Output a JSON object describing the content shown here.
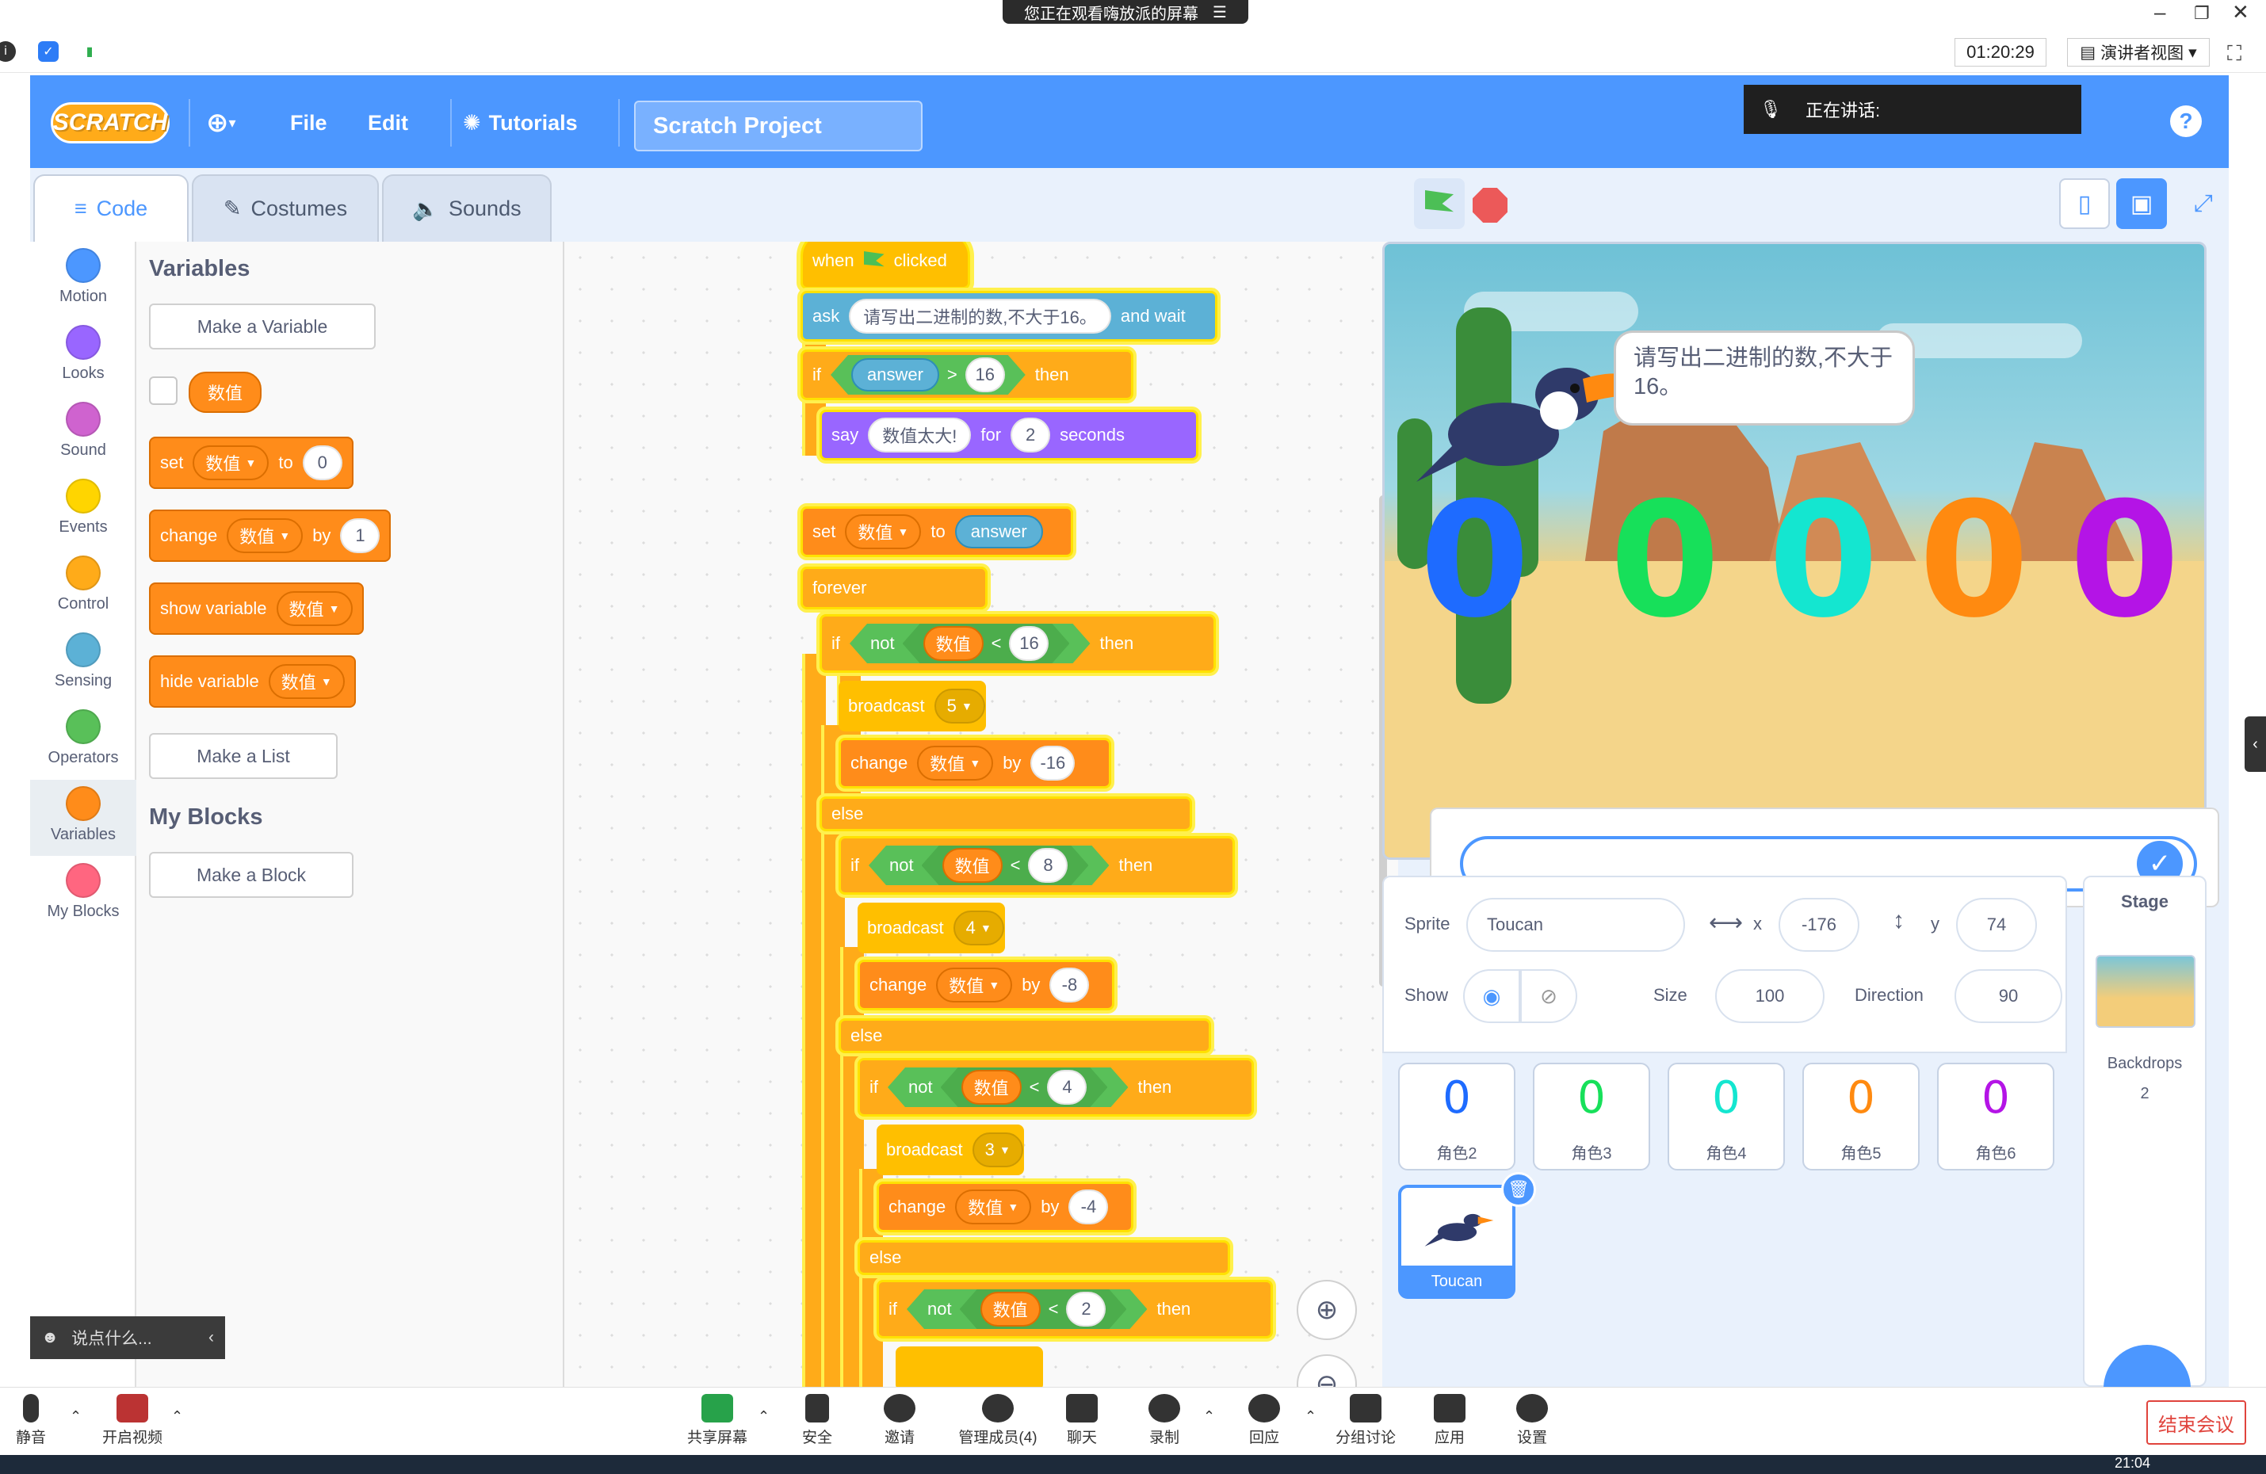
{
  "meeting": {
    "share_banner": "您正在观看嗨放派的屏幕",
    "timer": "01:20:29",
    "presenter_view": "演讲者视图",
    "speaking_label": "正在讲话:",
    "chat_placeholder": "说点什么...",
    "bottom": [
      {
        "label": "静音"
      },
      {
        "label": "开启视频"
      },
      {
        "label": "共享屏幕"
      },
      {
        "label": "安全"
      },
      {
        "label": "邀请"
      },
      {
        "label": "管理成员(4)"
      },
      {
        "label": "聊天"
      },
      {
        "label": "录制"
      },
      {
        "label": "回应"
      },
      {
        "label": "分组讨论"
      },
      {
        "label": "应用"
      },
      {
        "label": "设置"
      }
    ],
    "end_button": "结束会议",
    "clock": "21:04"
  },
  "scratch": {
    "logo": "SCRATCH",
    "menu": {
      "file": "File",
      "edit": "Edit",
      "tutorials": "Tutorials",
      "project_title": "Scratch Project"
    },
    "tabs": {
      "code": "Code",
      "costumes": "Costumes",
      "sounds": "Sounds"
    },
    "categories": [
      {
        "label": "Motion",
        "color": "#4c97ff"
      },
      {
        "label": "Looks",
        "color": "#9966ff"
      },
      {
        "label": "Sound",
        "color": "#cf63cf"
      },
      {
        "label": "Events",
        "color": "#ffd500"
      },
      {
        "label": "Control",
        "color": "#ffab19"
      },
      {
        "label": "Sensing",
        "color": "#5cb1d6"
      },
      {
        "label": "Operators",
        "color": "#59c059"
      },
      {
        "label": "Variables",
        "color": "#ff8c1a"
      },
      {
        "label": "My Blocks",
        "color": "#ff6680"
      }
    ],
    "palette": {
      "variables_heading": "Variables",
      "make_variable": "Make a Variable",
      "variable_name": "数值",
      "set_block": {
        "kw": "set",
        "var": "数值",
        "to": "to",
        "value": "0"
      },
      "change_block": {
        "kw": "change",
        "var": "数值",
        "by": "by",
        "value": "1"
      },
      "show_block": {
        "kw": "show variable",
        "var": "数值"
      },
      "hide_block": {
        "kw": "hide variable",
        "var": "数值"
      },
      "make_list": "Make a List",
      "myblocks_heading": "My Blocks",
      "make_block": "Make a Block"
    },
    "script": {
      "when_clicked": {
        "when": "when",
        "clicked": "clicked"
      },
      "ask": {
        "kw": "ask",
        "text": "请写出二进制的数,不大于16。",
        "wait": "and wait"
      },
      "if1": {
        "if": "if",
        "answer": "answer",
        "op": ">",
        "num": "16",
        "then": "then"
      },
      "say": {
        "kw": "say",
        "text": "数值太大!",
        "for": "for",
        "num": "2",
        "seconds": "seconds"
      },
      "set": {
        "kw": "set",
        "var": "数值",
        "to": "to",
        "value": "answer"
      },
      "forever": "forever",
      "if2": {
        "if": "if",
        "not": "not",
        "var": "数值",
        "op": "<",
        "num": "16",
        "then": "then"
      },
      "broadcast5": {
        "kw": "broadcast",
        "msg": "5"
      },
      "change16": {
        "kw": "change",
        "var": "数值",
        "by": "by",
        "num": "-16"
      },
      "else1": "else",
      "if3": {
        "if": "if",
        "not": "not",
        "var": "数值",
        "op": "<",
        "num": "8",
        "then": "then"
      },
      "broadcast4": {
        "kw": "broadcast",
        "msg": "4"
      },
      "change8": {
        "kw": "change",
        "var": "数值",
        "by": "by",
        "num": "-8"
      },
      "else2": "else",
      "if4": {
        "if": "if",
        "not": "not",
        "var": "数值",
        "op": "<",
        "num": "4",
        "then": "then"
      },
      "broadcast3": {
        "kw": "broadcast",
        "msg": "3"
      },
      "change4": {
        "kw": "change",
        "var": "数值",
        "by": "by",
        "num": "-4"
      },
      "else3": "else",
      "if5": {
        "if": "if",
        "not": "not",
        "var": "数值",
        "op": "<",
        "num": "2",
        "then": "then"
      }
    },
    "stage": {
      "speech": "请写出二进制的数,不大于16。",
      "digits": [
        {
          "text": "0",
          "color": "#1e6bff"
        },
        {
          "text": "0",
          "color": "#17e05a"
        },
        {
          "text": "0",
          "color": "#14e6d0"
        },
        {
          "text": "0",
          "color": "#ff8a10"
        },
        {
          "text": "0",
          "color": "#b414e6"
        }
      ]
    },
    "sprite_info": {
      "sprite_label": "Sprite",
      "sprite_name": "Toucan",
      "x_label": "x",
      "x_value": "-176",
      "y_label": "y",
      "y_value": "74",
      "show_label": "Show",
      "size_label": "Size",
      "size_value": "100",
      "direction_label": "Direction",
      "direction_value": "90"
    },
    "sprites": [
      {
        "glyph": "0",
        "name": "角色2",
        "color": "#1e6bff"
      },
      {
        "glyph": "0",
        "name": "角色3",
        "color": "#17e05a"
      },
      {
        "glyph": "0",
        "name": "角色4",
        "color": "#14e6d0"
      },
      {
        "glyph": "0",
        "name": "角色5",
        "color": "#ff8a10"
      },
      {
        "glyph": "0",
        "name": "角色6",
        "color": "#b414e6"
      }
    ],
    "selected_sprite": {
      "name": "Toucan"
    },
    "stage_pane": {
      "title": "Stage",
      "backdrops_label": "Backdrops",
      "backdrops_count": "2"
    }
  }
}
